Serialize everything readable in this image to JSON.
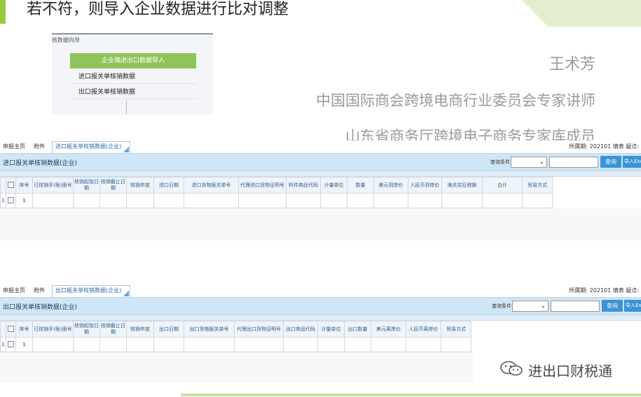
{
  "slide": {
    "title": "若不符，则导入企业数据进行比对调整"
  },
  "wizard": {
    "title": "核数据向导",
    "primary_button": "企业端进出口数据导入",
    "items": [
      "进口报关单核销数据",
      "出口报关单核销数据"
    ]
  },
  "presenter": {
    "name": "王术芳",
    "role": "中国国际商会跨境电商行业委员会专家讲师",
    "role2": "山东省商务厅跨境电子商务专家库成员"
  },
  "import_panel": {
    "tabs": {
      "home": "申报主页",
      "attachment": "附件",
      "active": "进口报关单核销数据(企业)"
    },
    "period": "所属期: 202101   填表  疑点:",
    "title": "进口报关单核销数据(企业)",
    "query_cond_label": "查询条件",
    "query_button": "查询",
    "import_button": "导入Excel",
    "columns": [
      "序号",
      "已核销手(账)册号",
      "核销起始日期",
      "核销截止日期",
      "核销年度",
      "进口日期",
      "进口货物报关单号",
      "代理进口货物证明号",
      "料件商品代码",
      "计量单位",
      "数量",
      "美元到岸价",
      "人民币到岸价",
      "海关实征税额",
      "合计",
      "贸易方式"
    ],
    "row_num": "1",
    "row_seq": "1"
  },
  "export_panel": {
    "tabs": {
      "home": "申报主页",
      "attachment": "附件",
      "active": "出口报关单核销数据(企业)"
    },
    "period": "所属期: 202101   填表  疑点:",
    "title": "出口报关单核销数据(企业)",
    "query_cond_label": "查询条件",
    "query_button": "查询",
    "import_button": "导入Excel",
    "columns": [
      "序号",
      "已核销手(账)册号",
      "核销起始日期",
      "核销截止日期",
      "核销年度",
      "出口日期",
      "出口货物报关单号",
      "代理出口货物证明号",
      "出口商品代码",
      "计量单位",
      "出口数量",
      "美元离岸价",
      "人民币离岸价",
      "贸易方式"
    ],
    "row_num": "1",
    "row_seq": "1"
  },
  "watermark": {
    "text": "进出口财税通",
    "icon": "wechat-icon"
  },
  "colors": {
    "accent_green": "#9dc93e",
    "toolbar_blue": "#cfe6f6",
    "button_blue": "#3a93d6"
  }
}
